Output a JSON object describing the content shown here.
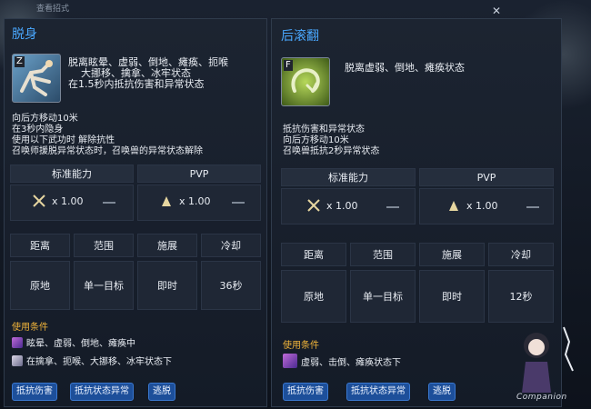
{
  "window": {
    "title": "查看招式",
    "close_icon": "close-icon"
  },
  "left": {
    "title": "脱身",
    "key": "Z",
    "desc": [
      "脱离眩晕、虚弱、倒地、瘫痪、扼喉",
      "大挪移、擒拿、冰牢状态",
      "在1.5秒内抵抗伤害和异常状态"
    ],
    "body": [
      "向后方移动10米",
      "在3秒内隐身",
      "使用以下武功时 解除抗性",
      "召唤师援脱异常状态时，召唤兽的异常状态解除"
    ],
    "headers": {
      "standard": "标准能力",
      "pvp": "PVP"
    },
    "stats": {
      "standard": "x 1.00",
      "pvp": "x 1.00"
    },
    "table": {
      "labels": [
        "距离",
        "范围",
        "施展",
        "冷却"
      ],
      "values": [
        "原地",
        "单一目标",
        "即时",
        "36秒"
      ]
    },
    "conditions": {
      "title": "使用条件",
      "lines": [
        "眩晕、虚弱、倒地、瘫痪中",
        "在擒拿、扼喉、大挪移、冰牢状态下"
      ]
    },
    "tags": [
      "抵抗伤害",
      "抵抗状态异常",
      "逃脱"
    ]
  },
  "right": {
    "title": "后滚翻",
    "key": "F",
    "desc": [
      "脱离虚弱、倒地、瘫痪状态"
    ],
    "body": [
      "抵抗伤害和异常状态",
      "向后方移动10米",
      "召唤兽抵抗2秒异常状态"
    ],
    "headers": {
      "standard": "标准能力",
      "pvp": "PVP"
    },
    "stats": {
      "standard": "x 1.00",
      "pvp": "x 1.00"
    },
    "table": {
      "labels": [
        "距离",
        "范围",
        "施展",
        "冷却"
      ],
      "values": [
        "原地",
        "单一目标",
        "即时",
        "12秒"
      ]
    },
    "conditions": {
      "title": "使用条件",
      "lines": [
        "虚弱、击倒、瘫痪状态下"
      ]
    },
    "tags": [
      "抵抗伤害",
      "抵抗状态异常",
      "逃脱"
    ]
  },
  "watermark": {
    "label": "Companion"
  },
  "colors": {
    "title_blue": "#4aa8ff",
    "condition_gold": "#f1b43a",
    "tag_blue": "#1d4f9a"
  }
}
